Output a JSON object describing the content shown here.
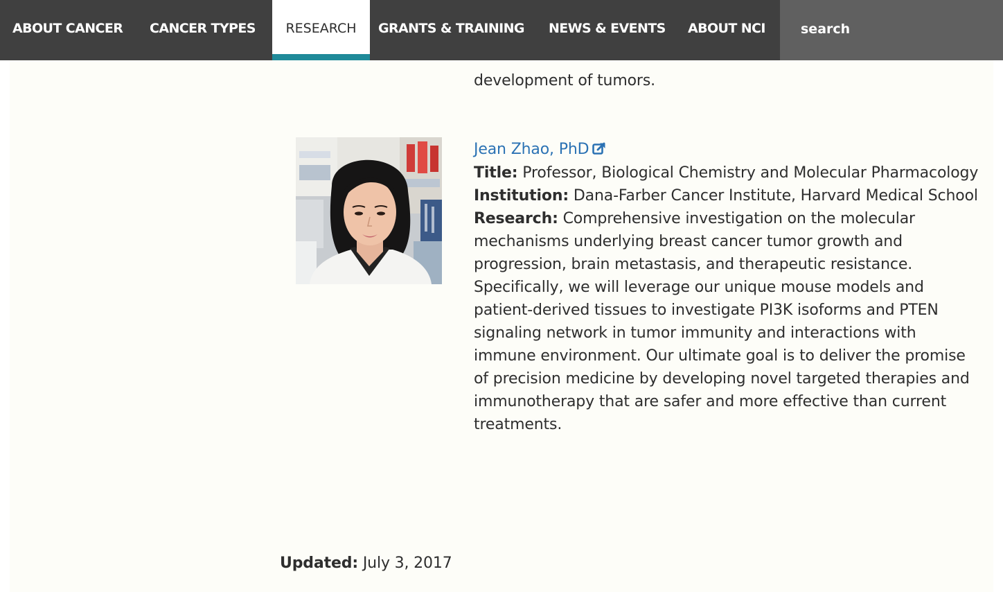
{
  "nav": {
    "items": [
      {
        "label": "ABOUT CANCER"
      },
      {
        "label": "CANCER TYPES"
      },
      {
        "label": "RESEARCH",
        "active": true
      },
      {
        "label": "GRANTS & TRAINING"
      },
      {
        "label": "NEWS & EVENTS"
      },
      {
        "label": "ABOUT NCI"
      }
    ],
    "search_placeholder": "search",
    "colors": {
      "bar": "#404040",
      "search_bg": "#606060",
      "active_underline": "#1f8a99"
    }
  },
  "previous_entry_tail": "development of tumors.",
  "profile": {
    "photo_icon": "portrait-photo",
    "name": "Jean Zhao, PhD",
    "name_link_icon": "external-link-icon",
    "title_label": "Title:",
    "title": "Professor, Biological Chemistry and Molecular Pharmacology",
    "institution_label": "Institution:",
    "institution": "Dana-Farber Cancer Institute, Harvard Medical School",
    "research_label": "Research:",
    "research": "Comprehensive investigation on the molecular mechanisms underlying breast cancer tumor growth and progression, brain metastasis, and therapeutic resistance. Specifically, we will leverage our unique mouse models and patient-derived tissues to investigate PI3K isoforms and PTEN signaling network in tumor immunity and interactions with immune environment. Our ultimate goal is to deliver the promise of precision medicine by developing novel targeted therapies and immunotherapy that are safer and more effective than current treatments."
  },
  "updated": {
    "label": "Updated:",
    "date": "July 3, 2017"
  },
  "colors": {
    "page_bg": "#fdfdf8",
    "link": "#2b72b4",
    "text": "#2e2e2e"
  }
}
